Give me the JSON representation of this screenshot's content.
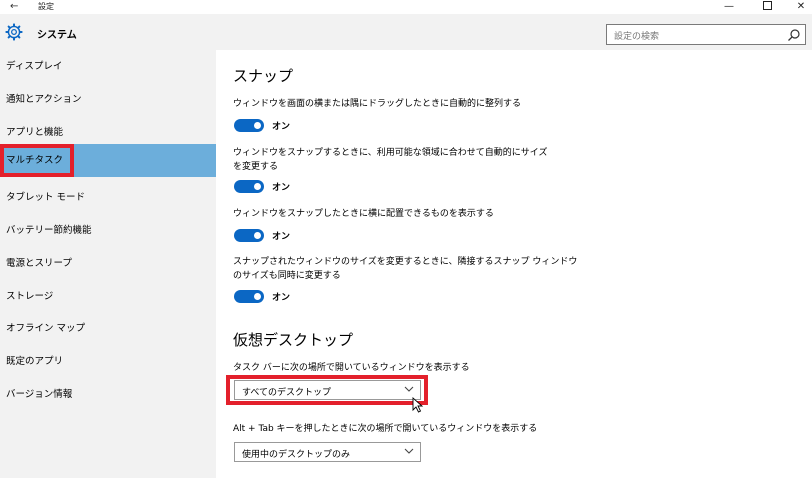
{
  "titlebar": {
    "back_icon": "back-arrow-icon",
    "title": "設定",
    "minimize": "—",
    "close": "✕"
  },
  "header": {
    "title": "システム",
    "icon": "gear-icon",
    "search_placeholder": "設定の検索"
  },
  "sidebar": {
    "items": [
      {
        "label": "ディスプレイ"
      },
      {
        "label": "通知とアクション"
      },
      {
        "label": "アプリと機能"
      },
      {
        "label": "マルチタスク",
        "selected": true
      },
      {
        "label": "タブレット モード"
      },
      {
        "label": "バッテリー節約機能"
      },
      {
        "label": "電源とスリープ"
      },
      {
        "label": "ストレージ"
      },
      {
        "label": "オフライン マップ"
      },
      {
        "label": "既定のアプリ"
      },
      {
        "label": "バージョン情報"
      }
    ]
  },
  "snap": {
    "heading": "スナップ",
    "settings": [
      {
        "label": "ウィンドウを画面の横または隅にドラッグしたときに自動的に整列する",
        "state": "オン"
      },
      {
        "label_line1": "ウィンドウをスナップするときに、利用可能な領域に合わせて自動的にサイズ",
        "label_line2": "を変更する",
        "state": "オン"
      },
      {
        "label": "ウィンドウをスナップしたときに横に配置できるものを表示する",
        "state": "オン"
      },
      {
        "label_line1": "スナップされたウィンドウのサイズを変更するときに、隣接するスナップ ウィンドウ",
        "label_line2": "のサイズも同時に変更する",
        "state": "オン"
      }
    ]
  },
  "virtual_desktops": {
    "heading": "仮想デスクトップ",
    "taskbar_label": "タスク バーに次の場所で開いているウィンドウを表示する",
    "taskbar_value": "すべてのデスクトップ",
    "alttab_label": "Alt + Tab キーを押したときに次の場所で開いているウィンドウを表示する",
    "alttab_value": "使用中のデスクトップのみ"
  },
  "colors": {
    "accent": "#0b67c4",
    "selected": "#6caedb",
    "highlight": "#e3202b",
    "sidebar_bg": "#f2f2f2"
  }
}
